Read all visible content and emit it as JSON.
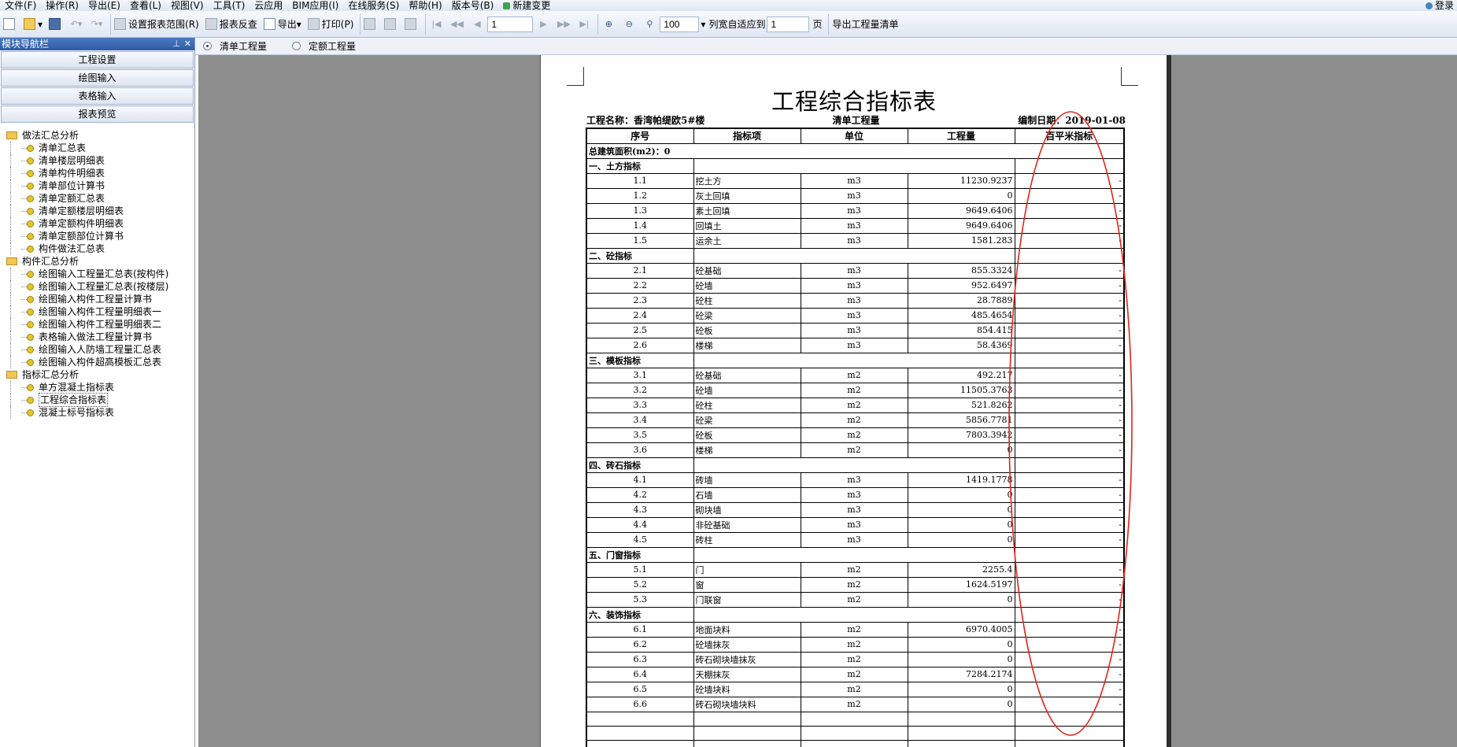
{
  "menu": [
    "文件(F)",
    "操作(R)",
    "导出(E)",
    "查看(L)",
    "视图(V)",
    "工具(T)",
    "云应用",
    "BIM应用(I)",
    "在线服务(S)",
    "帮助(H)",
    "版本号(B)",
    "新建变更"
  ],
  "login_label": "登录",
  "toolbar": {
    "set_range": "设置报表范围(R)",
    "reverse_check": "报表反查",
    "export": "导出",
    "print": "打印(P)",
    "page_value": "1",
    "zoom_value": "100",
    "fit_label": "列宽自适应到",
    "fit_value": "1",
    "page_unit": "页",
    "export_list": "导出工程量清单"
  },
  "left_panel": {
    "title": "模块导航栏",
    "modules": [
      "工程设置",
      "绘图输入",
      "表格输入",
      "报表预览"
    ],
    "groups": [
      {
        "label": "做法汇总分析",
        "items": [
          "清单汇总表",
          "清单楼层明细表",
          "清单构件明细表",
          "清单部位计算书",
          "清单定额汇总表",
          "清单定额楼层明细表",
          "清单定额构件明细表",
          "清单定额部位计算书",
          "构件做法汇总表"
        ]
      },
      {
        "label": "构件汇总分析",
        "items": [
          "绘图输入工程量汇总表(按构件)",
          "绘图输入工程量汇总表(按楼层)",
          "绘图输入构件工程量计算书",
          "绘图输入构件工程量明细表一",
          "绘图输入构件工程量明细表二",
          "表格输入做法工程量计算书",
          "绘图输入人防墙工程量汇总表",
          "绘图输入构件超高模板汇总表"
        ]
      },
      {
        "label": "指标汇总分析",
        "items": [
          "单方混凝土指标表",
          "工程综合指标表",
          "混凝土标号指标表"
        ]
      }
    ]
  },
  "options": {
    "opt1": "清单工程量",
    "opt2": "定额工程量"
  },
  "report": {
    "title": "工程综合指标表",
    "project": "工程名称：香湾帕缇欧5#楼",
    "mode": "清单工程量",
    "date": "编制日期：2019-01-08",
    "headers": [
      "序号",
      "指标项",
      "单位",
      "工程量",
      "百平米指标"
    ],
    "area_row": "总建筑面积(m2)：0",
    "sections": [
      {
        "label": "一、土方指标",
        "rows": [
          [
            "1.1",
            "挖土方",
            "m3",
            "11230.9237",
            "-"
          ],
          [
            "1.2",
            "灰土回填",
            "m3",
            "0",
            "-"
          ],
          [
            "1.3",
            "素土回填",
            "m3",
            "9649.6406",
            "-"
          ],
          [
            "1.4",
            "回填土",
            "m3",
            "9649.6406",
            "-"
          ],
          [
            "1.5",
            "运余土",
            "m3",
            "1581.283",
            "-"
          ]
        ]
      },
      {
        "label": "二、砼指标",
        "rows": [
          [
            "2.1",
            "砼基础",
            "m3",
            "855.3324",
            "-"
          ],
          [
            "2.2",
            "砼墙",
            "m3",
            "952.6497",
            "-"
          ],
          [
            "2.3",
            "砼柱",
            "m3",
            "28.7889",
            "-"
          ],
          [
            "2.4",
            "砼梁",
            "m3",
            "485.4654",
            "-"
          ],
          [
            "2.5",
            "砼板",
            "m3",
            "854.415",
            "-"
          ],
          [
            "2.6",
            "楼梯",
            "m3",
            "58.4369",
            "-"
          ]
        ]
      },
      {
        "label": "三、模板指标",
        "rows": [
          [
            "3.1",
            "砼基础",
            "m2",
            "492.217",
            "-"
          ],
          [
            "3.2",
            "砼墙",
            "m2",
            "11505.3763",
            "-"
          ],
          [
            "3.3",
            "砼柱",
            "m2",
            "521.8262",
            "-"
          ],
          [
            "3.4",
            "砼梁",
            "m2",
            "5856.7781",
            "-"
          ],
          [
            "3.5",
            "砼板",
            "m2",
            "7803.3942",
            "-"
          ],
          [
            "3.6",
            "楼梯",
            "m2",
            "0",
            "-"
          ]
        ]
      },
      {
        "label": "四、砖石指标",
        "rows": [
          [
            "4.1",
            "砖墙",
            "m3",
            "1419.1778",
            "-"
          ],
          [
            "4.2",
            "石墙",
            "m3",
            "0",
            "-"
          ],
          [
            "4.3",
            "砌块墙",
            "m3",
            "0",
            "-"
          ],
          [
            "4.4",
            "非砼基础",
            "m3",
            "0",
            "-"
          ],
          [
            "4.5",
            "砖柱",
            "m3",
            "0",
            "-"
          ]
        ]
      },
      {
        "label": "五、门窗指标",
        "rows": [
          [
            "5.1",
            "门",
            "m2",
            "2255.4",
            "-"
          ],
          [
            "5.2",
            "窗",
            "m2",
            "1624.5197",
            "-"
          ],
          [
            "5.3",
            "门联窗",
            "m2",
            "0",
            "-"
          ]
        ]
      },
      {
        "label": "六、装饰指标",
        "rows": [
          [
            "6.1",
            "地面块料",
            "m2",
            "6970.4005",
            "-"
          ],
          [
            "6.2",
            "砼墙抹灰",
            "m2",
            "0",
            "-"
          ],
          [
            "6.3",
            "砖石砌块墙抹灰",
            "m2",
            "0",
            "-"
          ],
          [
            "6.4",
            "天棚抹灰",
            "m2",
            "7284.2174",
            "-"
          ],
          [
            "6.5",
            "砼墙块料",
            "m2",
            "0",
            "-"
          ],
          [
            "6.6",
            "砖石砌块墙块料",
            "m2",
            "0",
            "-"
          ]
        ]
      }
    ]
  },
  "annotation_color": "#e0241b"
}
